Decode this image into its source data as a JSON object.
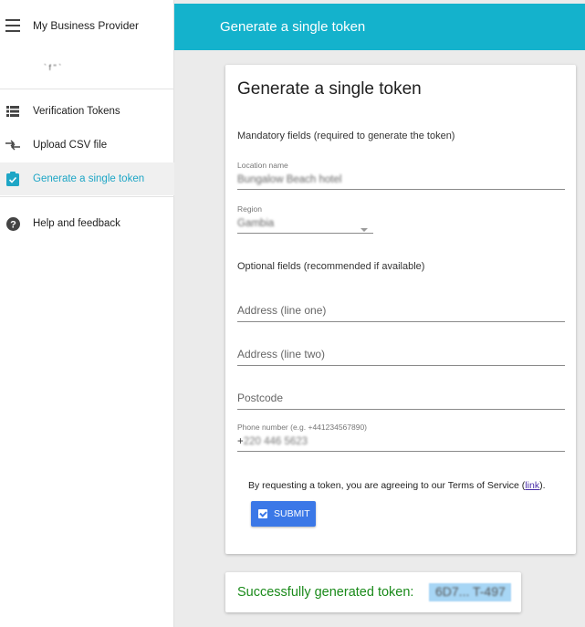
{
  "app": {
    "title": "My Business Provider",
    "subtitle": "` f \" `"
  },
  "sidebar": {
    "items": [
      {
        "label": "Verification Tokens",
        "icon": "list-icon"
      },
      {
        "label": "Upload CSV file",
        "icon": "upload-arrows-icon"
      },
      {
        "label": "Generate a single token",
        "icon": "clipboard-check-icon"
      },
      {
        "label": "Help and feedback",
        "icon": "help-icon"
      }
    ]
  },
  "topbar": {
    "title": "Generate a single token"
  },
  "form": {
    "title": "Generate a single token",
    "mandatory_label": "Mandatory fields (required to generate the token)",
    "location_label": "Location name",
    "location_value": "Bungalow Beach hotel",
    "region_label": "Region",
    "region_value": "Gambia",
    "optional_label": "Optional fields (recommended if available)",
    "address1_placeholder": "Address (line one)",
    "address2_placeholder": "Address (line two)",
    "postcode_placeholder": "Postcode",
    "phone_label": "Phone number (e.g. +441234567890)",
    "phone_prefix": "+",
    "phone_value": "220 446 5623",
    "terms_text": "By requesting a token, you are agreeing to our Terms of Service (",
    "terms_link": "link",
    "terms_end": ").",
    "submit_label": "SUBMIT"
  },
  "success": {
    "message": "Successfully generated token:",
    "token": "6D7... T-497"
  },
  "colors": {
    "accent": "#14b2cc",
    "button": "#3b78e7",
    "success": "#1a8a1a"
  }
}
